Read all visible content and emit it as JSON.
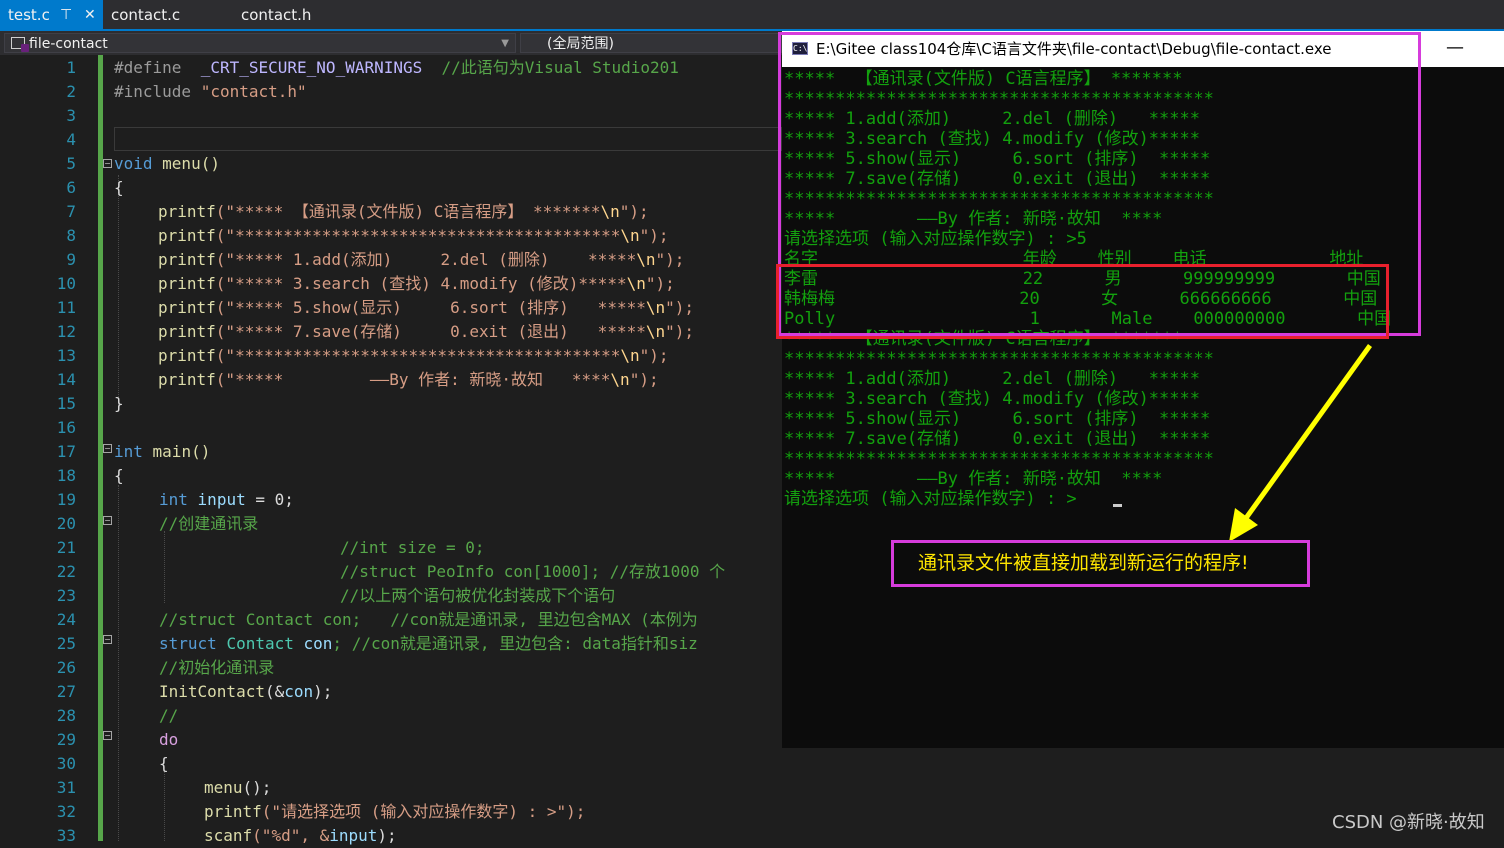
{
  "tabs": [
    {
      "label": "test.c",
      "pin": "⊤",
      "close": "✕"
    },
    {
      "label": "contact.c"
    },
    {
      "label": "contact.h"
    }
  ],
  "nav": {
    "project": "file-contact",
    "scope": "(全局范围)"
  },
  "line_numbers": [
    "1",
    "2",
    "3",
    "4",
    "5",
    "6",
    "7",
    "8",
    "9",
    "10",
    "11",
    "12",
    "13",
    "14",
    "15",
    "16",
    "17",
    "18",
    "19",
    "20",
    "21",
    "22",
    "23",
    "24",
    "25",
    "26",
    "27",
    "28",
    "29",
    "30",
    "31",
    "32",
    "33"
  ],
  "code": {
    "l1a": "#define  ",
    "l1b": "_CRT_SECURE_NO_WARNINGS",
    "l1c": "  //此语句为Visual Studio201",
    "l2a": "#include ",
    "l2b": "\"contact.h\"",
    "l5a": "void",
    "l5b": " menu()",
    "l6": "{",
    "p": "printf",
    "l7": "(\"***** 【通讯录(文件版) C语言程序】 *******",
    "l8": "(\"****************************************",
    "l9": "(\"***** 1.add(添加)     2.del (删除)    *****",
    "l10": "(\"***** 3.search (查找) 4.modify (修改)*****",
    "l11": "(\"***** 5.show(显示)     6.sort (排序)   *****",
    "l12": "(\"***** 7.save(存储)     0.exit (退出)   *****",
    "l13": "(\"****************************************",
    "l14": "(\"*****         ——By 作者: 新晓·故知   ****",
    "esc": "\\n",
    "close": "\");",
    "l15": "}",
    "l17a": "int",
    "l17b": " main()",
    "l18": "{",
    "l19a": "int",
    "l19b": "input",
    "l19c": " = 0;",
    "l20": "//创建通讯录",
    "l21": "//int size = 0;",
    "l22": "//struct PeoInfo con[1000]; //存放1000 个",
    "l23": "//以上两个语句被优化封装成下个语句",
    "l24": "//struct Contact con;   //con就是通讯录, 里边包含MAX (本例为",
    "l25a": "struct",
    "l25b": "Contact",
    "l25c": "con",
    "l25d": "; //con就是通讯录, 里边包含: data指针和siz",
    "l26": "//初始化通讯录",
    "l27a": "InitContact",
    "l27b": "(&",
    "l27c": "con",
    "l27d": ");",
    "l28": "//",
    "l29": "do",
    "l30": "{",
    "l31a": "menu",
    "l31b": "();",
    "l32a": "printf",
    "l32b": "(\"请选择选项 (输入对应操作数字) : >\");",
    "l33a": "scanf",
    "l33b": "(\"%d\", &",
    "l33c": "input",
    "l33d": ");"
  },
  "console": {
    "title": "E:\\Gitee class104仓库\\C语言文件夹\\file-contact\\Debug\\file-contact.exe",
    "icon_label": "C:\\",
    "minimize": "—",
    "lines": [
      "*****  【通讯录(文件版) C语言程序】 *******",
      "******************************************",
      "***** 1.add(添加)     2.del (删除)   *****",
      "***** 3.search (查找) 4.modify (修改)*****",
      "***** 5.show(显示)     6.sort (排序)  *****",
      "***** 7.save(存储)     0.exit (退出)  *****",
      "******************************************",
      "*****        ——By 作者: 新晓·故知  ****",
      "请选择选项 (输入对应操作数字) : >5",
      "名字                    年龄    性别    电话            地址",
      "李雷                    22      男      999999999       中国",
      "韩梅梅                  20      女      666666666       中国",
      "Polly                   1       Male    000000000       中国",
      "*****  【通讯录(文件版) C语言程序】 *******",
      "******************************************",
      "***** 1.add(添加)     2.del (删除)   *****",
      "***** 3.search (查找) 4.modify (修改)*****",
      "***** 5.show(显示)     6.sort (排序)  *****",
      "***** 7.save(存储)     0.exit (退出)  *****",
      "******************************************",
      "*****        ——By 作者: 新晓·故知  ****",
      "请选择选项 (输入对应操作数字) : >"
    ]
  },
  "annotation": {
    "callout": "通讯录文件被直接加载到新运行的程序!"
  },
  "watermark": "CSDN @新晓·故知",
  "colors": {
    "accent": "#007acc",
    "console_text": "#13a10e",
    "highlight_box": "#d63cdc",
    "data_box": "#e8202d",
    "arrow": "#ffff00"
  }
}
